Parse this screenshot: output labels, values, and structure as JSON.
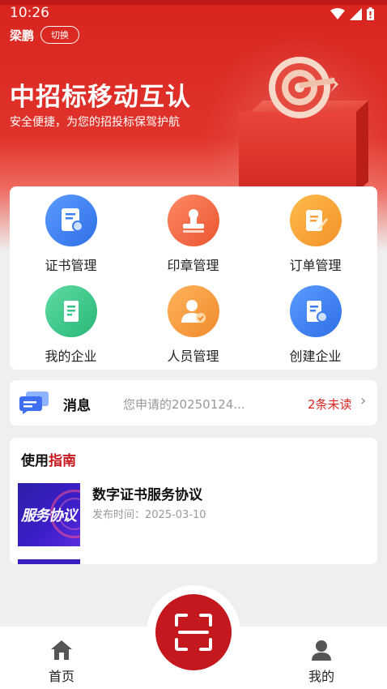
{
  "status_bar": {
    "time": "10:26"
  },
  "user": {
    "name": "梁鹏",
    "switch_label": "切换"
  },
  "hero": {
    "title": "中招标移动互认",
    "subtitle": "安全便捷，为您的招投标保驾护航"
  },
  "grid": [
    {
      "label": "证书管理",
      "icon": "certificate-icon",
      "color": "#3c7cf0"
    },
    {
      "label": "印章管理",
      "icon": "seal-icon",
      "color": "#f06a45"
    },
    {
      "label": "订单管理",
      "icon": "order-icon",
      "color": "#f5a23a"
    },
    {
      "label": "我的企业",
      "icon": "my-enterprise-icon",
      "color": "#38c58a"
    },
    {
      "label": "人员管理",
      "icon": "personnel-icon",
      "color": "#f39a3e"
    },
    {
      "label": "创建企业",
      "icon": "create-enterprise-icon",
      "color": "#3c7cf0"
    }
  ],
  "message": {
    "title": "消息",
    "preview": "您申请的20250124...",
    "unread": "2条未读",
    "chevron": "›"
  },
  "guide": {
    "title_prefix": "使用",
    "title_highlight": "指南",
    "items": [
      {
        "thumb_text": "服务协议",
        "title": "数字证书服务协议",
        "date": "发布时间：2025-03-10"
      }
    ]
  },
  "bottom_nav": {
    "home_label": "首页",
    "mine_label": "我的"
  },
  "colors": {
    "brand_red": "#d9241f",
    "scan_red": "#c4181e"
  }
}
